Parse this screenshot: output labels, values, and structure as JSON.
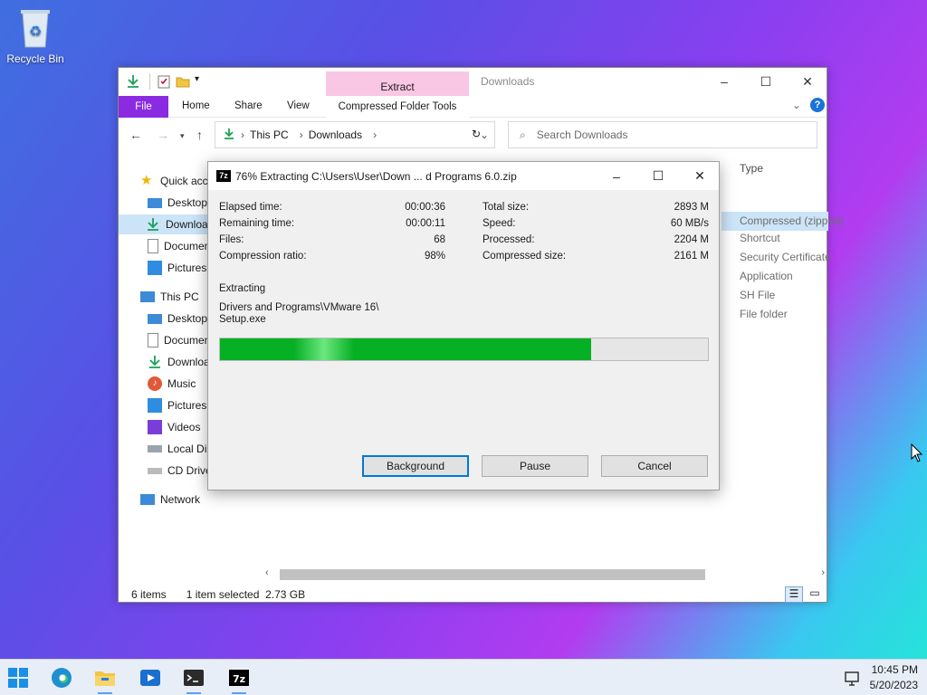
{
  "desktop": {
    "recycle_bin_label": "Recycle Bin"
  },
  "explorer": {
    "title": "Downloads",
    "context_tab": "Extract",
    "ribbon": {
      "file": "File",
      "home": "Home",
      "share": "Share",
      "view": "View",
      "compressed_tools": "Compressed Folder Tools"
    },
    "address": {
      "crumbs": [
        "This PC",
        "Downloads"
      ]
    },
    "search_placeholder": "Search Downloads",
    "nav": [
      {
        "label": "Quick access"
      },
      {
        "label": "Desktop"
      },
      {
        "label": "Downloads"
      },
      {
        "label": "Documents"
      },
      {
        "label": "Pictures"
      },
      {
        "label": "This PC"
      },
      {
        "label": "Desktop"
      },
      {
        "label": "Documents"
      },
      {
        "label": "Downloads"
      },
      {
        "label": "Music"
      },
      {
        "label": "Pictures"
      },
      {
        "label": "Videos"
      },
      {
        "label": "Local Disk"
      },
      {
        "label": "CD Drive"
      },
      {
        "label": "Network"
      }
    ],
    "type_header": "Type",
    "types": [
      "Compressed (zipped)",
      "Shortcut",
      "Security Certificate",
      "Application",
      "SH File",
      "File folder"
    ],
    "status": {
      "items": "6 items",
      "selection": "1 item selected  2.73 GB"
    }
  },
  "dialog": {
    "title": "76% Extracting C:\\Users\\User\\Down ... d Programs 6.0.zip",
    "stats_left": [
      {
        "label": "Elapsed time:",
        "value": "00:00:36"
      },
      {
        "label": "Remaining time:",
        "value": "00:00:11"
      },
      {
        "label": "Files:",
        "value": "68"
      },
      {
        "label": "Compression ratio:",
        "value": "98%"
      }
    ],
    "stats_right": [
      {
        "label": "Total size:",
        "value": "2893 M"
      },
      {
        "label": "Speed:",
        "value": "60 MB/s"
      },
      {
        "label": "Processed:",
        "value": "2204 M"
      },
      {
        "label": "Compressed size:",
        "value": "2161 M"
      }
    ],
    "operation": "Extracting",
    "current_path_line1": "Drivers and Programs\\VMware 16\\",
    "current_path_line2": "Setup.exe",
    "progress": 0.76,
    "buttons": {
      "background": "Background",
      "pause": "Pause",
      "cancel": "Cancel"
    }
  },
  "taskbar": {
    "time": "10:45 PM",
    "date": "5/20/2023"
  }
}
